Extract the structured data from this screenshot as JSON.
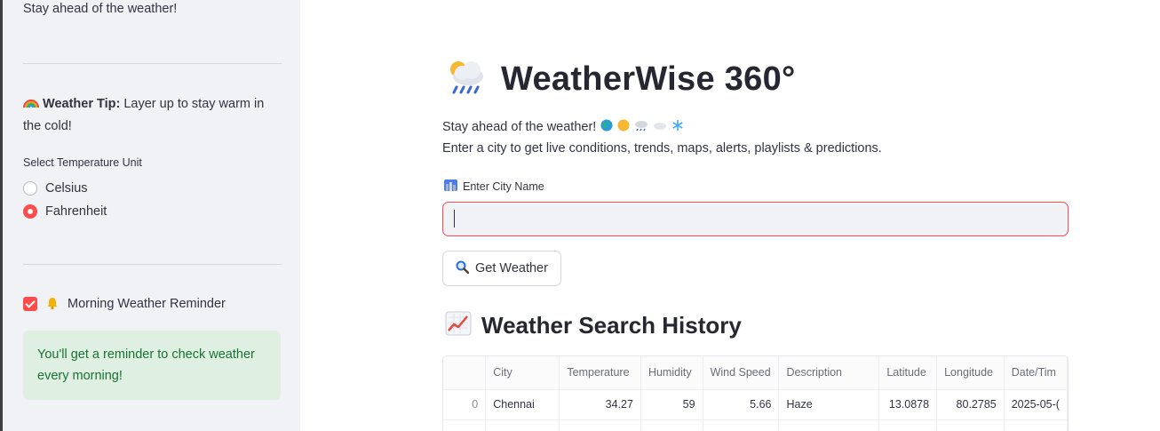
{
  "sidebar": {
    "tagline": "Stay ahead of the weather!",
    "tip_label": "Weather Tip:",
    "tip_text": " Layer up to stay warm in the cold!",
    "tip_icon": "rainbow-icon",
    "unit_label": "Select Temperature Unit",
    "unit_options": [
      "Celsius",
      "Fahrenheit"
    ],
    "unit_selected": "Fahrenheit",
    "reminder_label": "Morning Weather Reminder",
    "reminder_checked": true,
    "reminder_icon": "bell-icon",
    "reminder_message": "You'll get a reminder to check weather every morning!"
  },
  "main": {
    "title": "WeatherWise 360°",
    "title_icon": "cloud-sun-rain-icon",
    "subtitle": "Stay ahead of the weather!",
    "subtitle_icons": [
      "globe-icon",
      "sun-icon",
      "rain-cloud-icon",
      "cloud-icon",
      "snowflake-icon"
    ],
    "description": "Enter a city to get live conditions, trends, maps, alerts, playlists & predictions.",
    "city_label": "Enter City Name",
    "city_label_icon": "cityscape-icon",
    "city_value": "",
    "button_label": "Get Weather",
    "button_icon": "magnifier-icon",
    "history_title": "Weather Search History",
    "history_icon": "chart-increasing-icon"
  },
  "history_table": {
    "columns": [
      "",
      "City",
      "Temperature",
      "Humidity",
      "Wind Speed",
      "Description",
      "Latitude",
      "Longitude",
      "Date/Tim"
    ],
    "rows": [
      [
        "0",
        "Chennai",
        "34.27",
        "59",
        "5.66",
        "Haze",
        "13.0878",
        "80.2785",
        "2025-05-("
      ]
    ]
  },
  "colors": {
    "accent": "#ff4b4b",
    "sidebar_bg": "#f0f2f6",
    "success_bg": "#dff0e3",
    "success_text": "#177233"
  }
}
